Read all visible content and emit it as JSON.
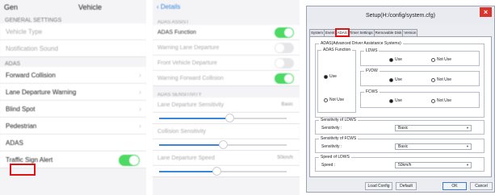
{
  "panel1": {
    "header_left": "Gen",
    "header_right": "Vehicle",
    "sections": [
      {
        "label": "GENERAL SETTINGS",
        "items": [
          {
            "label": "Vehicle Type",
            "faint": true
          },
          {
            "label": "Notification Sound",
            "faint": true
          }
        ]
      },
      {
        "label": "ADAS",
        "items": [
          {
            "label": "Forward Collision",
            "chevron": "›"
          },
          {
            "label": "Lane Departure Warning",
            "chevron": "›"
          },
          {
            "label": "Blind Spot",
            "chevron": "›"
          },
          {
            "label": "Pedestrian",
            "chevron": "›"
          },
          {
            "label": "ADAS",
            "chevron": ""
          },
          {
            "label": "Traffic Sign Alert",
            "toggle": true
          }
        ]
      }
    ]
  },
  "panel2": {
    "back_label": "‹ Details",
    "sections": [
      {
        "label": "ADAS ASSIST"
      },
      {
        "label": "ADAS SENSITIVITY"
      }
    ],
    "toggles": [
      {
        "label": "ADAS Function",
        "on": true
      },
      {
        "label": "Warning Lane Departure",
        "on": false
      },
      {
        "label": "Front Vehicle Departure",
        "on": false
      },
      {
        "label": "Warning Forward Collision",
        "on": true
      }
    ],
    "sliders": [
      {
        "label": "Lane Departure Sensitivity",
        "value_text": "Basic",
        "level": 0.55
      },
      {
        "label": "Collision Sensitivity",
        "value_text": "",
        "level": 0.5
      },
      {
        "label": "Lane Departure Speed",
        "value_text": "50km/h",
        "level": 0.45
      }
    ]
  },
  "dialog": {
    "title": "Setup(H:/config/system.cfg)",
    "close_label": "×",
    "tabs": [
      "System",
      "Event",
      "ADAS",
      "Timer Settings",
      "Removable Disk",
      "Version"
    ],
    "active_tab": "ADAS",
    "group_title": "ADAS(Advanced Driver Assistance Systems)",
    "adas_function": {
      "legend": "ADAS Function",
      "use_label": "Use",
      "not_use_label": "Not Use",
      "selected": "Use"
    },
    "ldws": {
      "legend": "LDWS",
      "use_label": "Use",
      "not_use_label": "Not Use",
      "selected": "Use"
    },
    "fvdw": {
      "legend": "FVDW",
      "use_label": "Use",
      "not_use_label": "Not Use",
      "selected": "Use"
    },
    "fcws": {
      "legend": "FCWS",
      "use_label": "Use",
      "not_use_label": "Not Use",
      "selected": "Use"
    },
    "sens_ldws": {
      "legend": "Sensitivity of LDWS",
      "label": "Sensitivity :",
      "value": "Basic"
    },
    "sens_fcws": {
      "legend": "Sensitivity of FCWS",
      "label": "Sensitivity :",
      "value": "Basic"
    },
    "speed_ldws": {
      "legend": "Speed of LDWS",
      "label": "Speed :",
      "value": "50km/h"
    },
    "buttons": {
      "load": "Load Config",
      "default": "Default",
      "ok": "OK",
      "cancel": "Cancel"
    },
    "colors": {
      "highlight": "#e01212",
      "close": "#d9352c"
    }
  }
}
